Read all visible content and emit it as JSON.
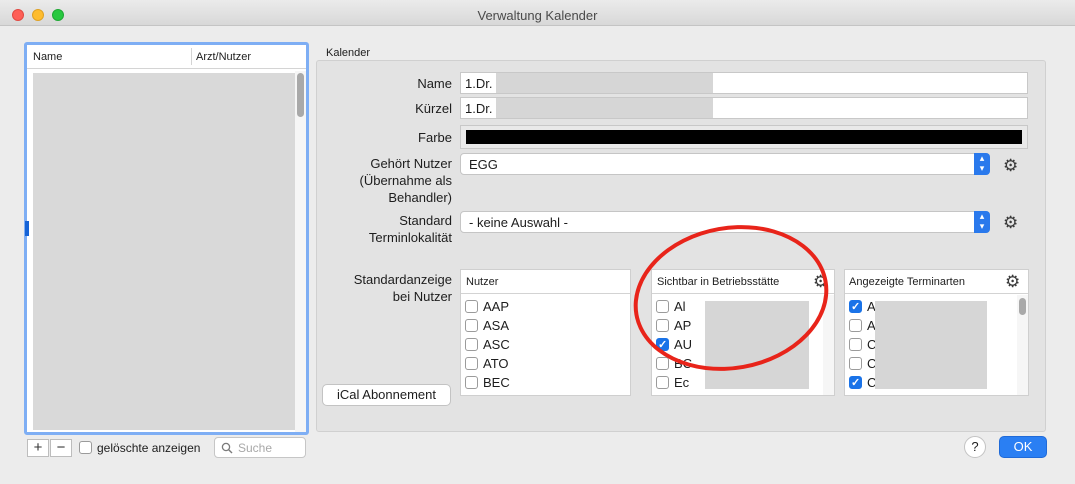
{
  "window": {
    "title": "Verwaltung Kalender"
  },
  "left_list": {
    "col_name": "Name",
    "col_arzt": "Arzt/Nutzer"
  },
  "bottom_left": {
    "add": "+",
    "remove": "−",
    "show_deleted_label": "gelöschte anzeigen",
    "search_placeholder": "Suche"
  },
  "form": {
    "group_label": "Kalender",
    "name_label": "Name",
    "name_value": "1.Dr.",
    "kuerzel_label": "Kürzel",
    "kuerzel_value": "1.Dr.",
    "farbe_label": "Farbe",
    "farbe_color": "#000000",
    "owner_label_1": "Gehört Nutzer",
    "owner_label_2": "(Übernahme als",
    "owner_label_3": "Behandler)",
    "owner_value": "EGG",
    "location_label_1": "Standard",
    "location_label_2": "Terminlokalität",
    "location_value": "- keine Auswahl -",
    "default_view_label_1": "Standardanzeige",
    "default_view_label_2": "bei Nutzer",
    "ical_button": "iCal Abonnement"
  },
  "nutzer_table": {
    "header": "Nutzer",
    "rows": [
      {
        "label": "AAP",
        "checked": false
      },
      {
        "label": "ASA",
        "checked": false
      },
      {
        "label": "ASC",
        "checked": false
      },
      {
        "label": "ATO",
        "checked": false
      },
      {
        "label": "BEC",
        "checked": false
      }
    ]
  },
  "sichtbar_table": {
    "header": "Sichtbar in Betriebsstätte",
    "rows": [
      {
        "label": "Al",
        "checked": false
      },
      {
        "label": "AP",
        "checked": false
      },
      {
        "label": "AU",
        "checked": true
      },
      {
        "label": "BC",
        "checked": false
      },
      {
        "label": "Ec",
        "checked": false
      }
    ]
  },
  "terminarten_table": {
    "header": "Angezeigte Terminarten",
    "rows": [
      {
        "label": "A",
        "checked": true
      },
      {
        "label": "A",
        "checked": false
      },
      {
        "label": "C",
        "checked": false
      },
      {
        "label": "C",
        "checked": false
      },
      {
        "label": "C",
        "checked": true
      }
    ]
  },
  "footer": {
    "help": "?",
    "ok": "OK"
  },
  "colors": {
    "accent": "#2a7ff3",
    "annotation_ring": "#e8241a"
  },
  "icons": [
    "gear-icon",
    "search-icon",
    "popup-chevron-icon"
  ]
}
